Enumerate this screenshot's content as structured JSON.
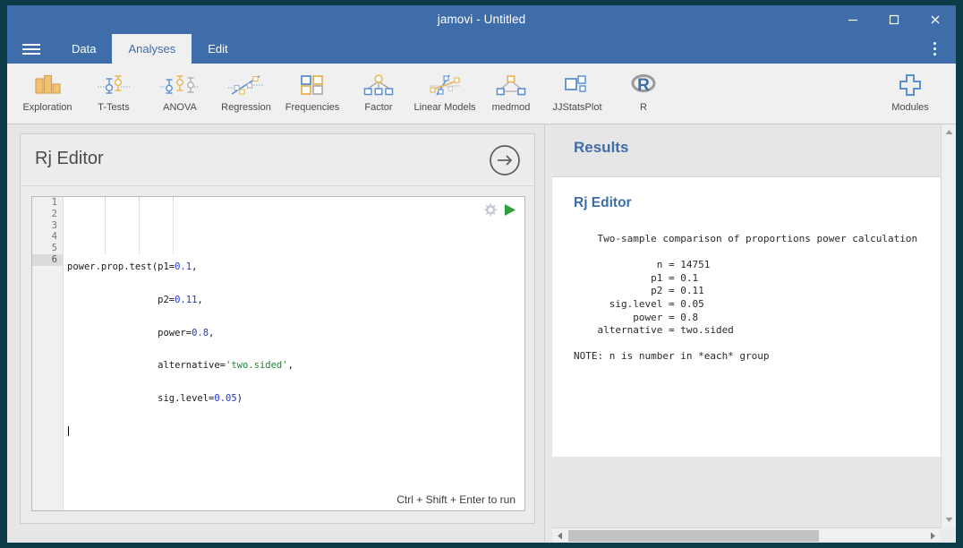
{
  "window": {
    "title": "jamovi - Untitled",
    "buttons": [
      {
        "name": "minimize",
        "glyph": "minimize-icon"
      },
      {
        "name": "maximize",
        "glyph": "maximize-icon"
      },
      {
        "name": "close",
        "glyph": "close-icon"
      }
    ]
  },
  "tabs": {
    "menu_icon": "hamburger-icon",
    "items": [
      {
        "label": "Data",
        "active": false
      },
      {
        "label": "Analyses",
        "active": true
      },
      {
        "label": "Edit",
        "active": false
      }
    ],
    "overflow_icon": "kebab-menu-icon"
  },
  "ribbon": {
    "items": [
      {
        "label": "Exploration",
        "icon": "bar-chart-icon"
      },
      {
        "label": "T-Tests",
        "icon": "t-test-icon"
      },
      {
        "label": "ANOVA",
        "icon": "anova-icon"
      },
      {
        "label": "Regression",
        "icon": "regression-icon"
      },
      {
        "label": "Frequencies",
        "icon": "frequencies-icon"
      },
      {
        "label": "Factor",
        "icon": "factor-icon"
      },
      {
        "label": "Linear Models",
        "icon": "linear-models-icon"
      },
      {
        "label": "medmod",
        "icon": "medmod-icon"
      },
      {
        "label": "JJStatsPlot",
        "icon": "jjstatsplot-icon"
      },
      {
        "label": "R",
        "icon": "r-logo-icon"
      }
    ],
    "modules": {
      "label": "Modules",
      "icon": "plus-icon"
    }
  },
  "editor": {
    "title": "Rj Editor",
    "forward_icon": "arrow-right-circle-icon",
    "settings_icon": "gear-icon",
    "run_icon": "play-icon",
    "hint": "Ctrl + Shift + Enter to run",
    "line_numbers": [
      "1",
      "2",
      "3",
      "4",
      "5",
      "6"
    ],
    "current_line": 6,
    "code_lines": [
      {
        "pre": "power.prop.test(p1=",
        "num": "0.1",
        "post": ","
      },
      {
        "pre": "                p2=",
        "num": "0.11",
        "post": ","
      },
      {
        "pre": "                power=",
        "num": "0.8",
        "post": ","
      },
      {
        "pre": "                alternative=",
        "str": "'two.sided'",
        "post": ","
      },
      {
        "pre": "                sig.level=",
        "num": "0.05",
        "post": ")"
      },
      {
        "pre": "",
        "post": ""
      }
    ]
  },
  "results": {
    "title": "Results",
    "subtitle": "Rj Editor",
    "output": "    Two-sample comparison of proportions power calculation \n\n              n = 14751\n             p1 = 0.1\n             p2 = 0.11\n      sig.level = 0.05\n          power = 0.8\n    alternative = two.sided\n\nNOTE: n is number in *each* group"
  },
  "scrollbars": {
    "vertical": {
      "up_icon": "caret-up-icon",
      "down_icon": "caret-down-icon"
    },
    "horizontal": {
      "left_icon": "caret-left-icon",
      "right_icon": "caret-right-icon"
    }
  },
  "colors": {
    "brand_blue": "#3e6daa",
    "accent_orange": "#e8b457",
    "icon_blue": "#5b8fd4",
    "run_green": "#2e9e3e",
    "desktop": "#0d3b47"
  }
}
